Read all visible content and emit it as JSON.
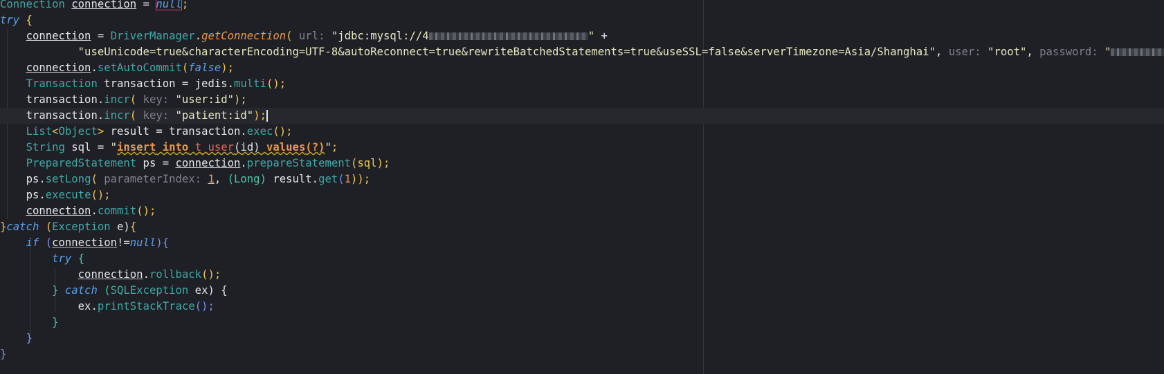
{
  "editor": {
    "lines": [
      [
        "Connection",
        " ",
        "connection",
        " = ",
        "null",
        ";"
      ],
      [
        "try",
        " {"
      ],
      [
        "    ",
        "connection",
        " = ",
        "DriverManager",
        ".",
        "getConnection",
        "(",
        " url: ",
        "\"jdbc:mysql://4",
        "\"",
        " +"
      ],
      [
        "            ",
        "\"useUnicode=true&characterEncoding=UTF-8&autoReconnect=true&rewriteBatchedStatements=true&useSSL=false&serverTimezone=Asia/Shanghai\"",
        ", ",
        "user:",
        " ",
        "\"root\"",
        ", ",
        "password:",
        " ",
        "\"",
        ";"
      ],
      [
        "    ",
        "connection",
        ".",
        "setAutoCommit",
        "(",
        "false",
        ");"
      ],
      [
        "    ",
        "Transaction",
        " transaction = jedis.",
        "multi",
        "();"
      ],
      [
        "    ",
        "transaction.",
        "incr",
        "(",
        " key: ",
        "\"user:id\"",
        ");"
      ],
      [
        "    ",
        "transaction.",
        "incr",
        "(",
        " key: ",
        "\"patient:id\"",
        ");"
      ],
      [
        "    ",
        "List",
        "<",
        "Object",
        ">",
        " result = transaction.",
        "exec",
        "();"
      ],
      [
        "    ",
        "String",
        " sql = ",
        "\"",
        "insert",
        " ",
        "into",
        " ",
        "t_user",
        "(",
        "id",
        ")",
        " ",
        "values",
        "(?)",
        "\"",
        ";"
      ],
      [
        "    ",
        "PreparedStatement",
        " ps = ",
        "connection",
        ".",
        "prepareStatement",
        "(sql);"
      ],
      [
        "    ",
        "ps.",
        "setLong",
        "(",
        " parameterIndex: ",
        "1",
        ", ",
        "(Long)",
        " result.",
        "get",
        "(",
        "1",
        "));"
      ],
      [
        "    ",
        "ps.",
        "execute",
        "();"
      ],
      [
        "    ",
        "connection",
        ".",
        "commit",
        "();"
      ],
      [
        "}",
        "catch",
        " (",
        "Exception",
        " e)",
        "{"
      ],
      [
        "    ",
        "if",
        " (",
        "connection",
        "!=",
        "null",
        ")",
        "{"
      ],
      [
        "        ",
        "try",
        " {"
      ],
      [
        "            ",
        "connection",
        ".",
        "rollback",
        "();"
      ],
      [
        "        ",
        "}",
        " ",
        "catch",
        " (",
        "SQLException",
        " ex) {"
      ],
      [
        "            ",
        "ex.",
        "printStackTrace",
        "();"
      ],
      [
        "        ",
        "}"
      ],
      [
        "    ",
        "}"
      ],
      [
        "}"
      ]
    ]
  }
}
